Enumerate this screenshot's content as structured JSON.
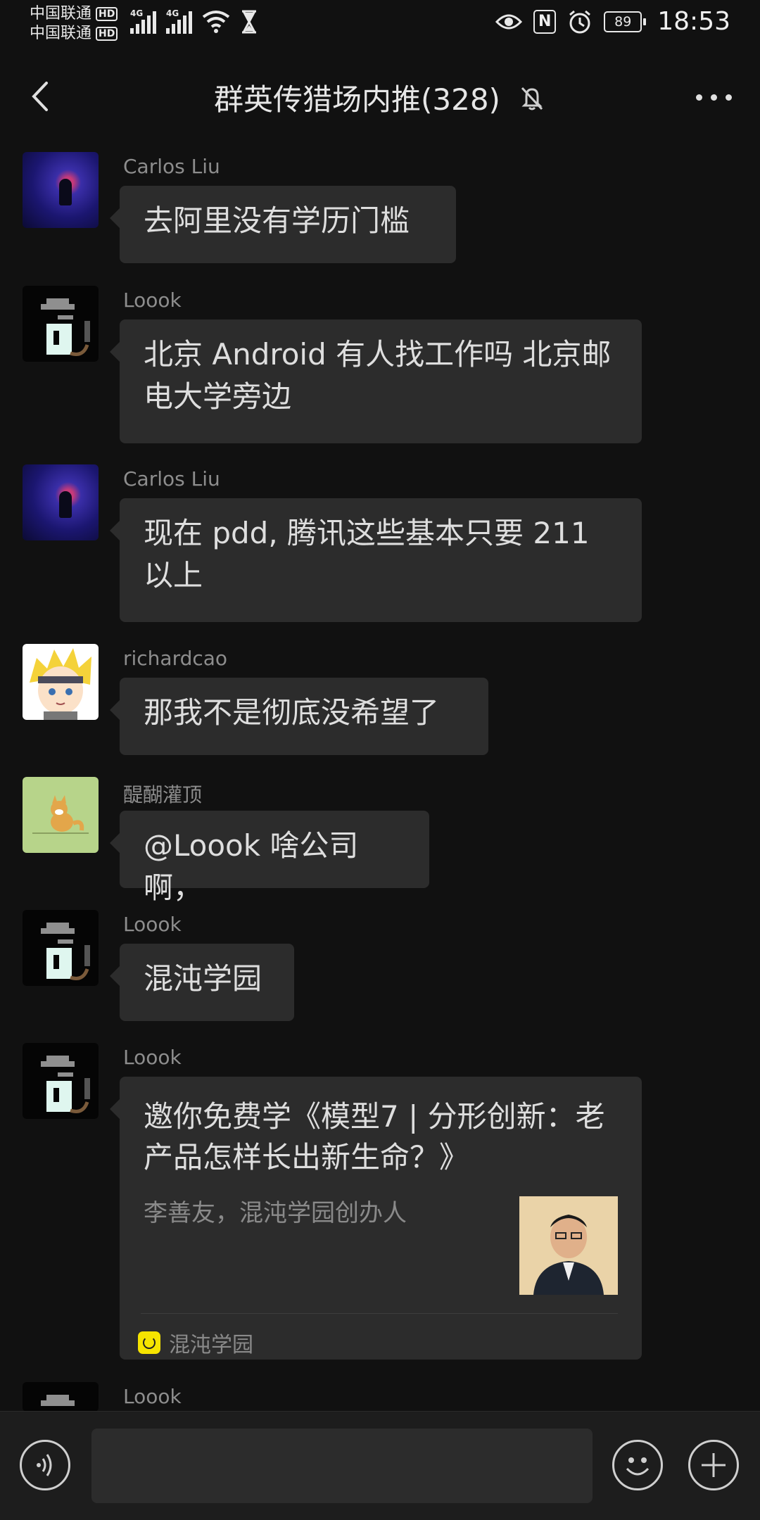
{
  "status_bar": {
    "carrier_1": "中国联通",
    "carrier_2": "中国联通",
    "hd_badge": "HD",
    "network_1": "4G",
    "network_2": "4G",
    "battery": "89",
    "time": "18:53",
    "icons": [
      "signal-icon",
      "wifi-icon",
      "hourglass-icon",
      "eye-icon",
      "nfc-icon",
      "alarm-icon",
      "battery-icon"
    ]
  },
  "header": {
    "title": "群英传猎场内推(328)",
    "icons": [
      "back-icon",
      "mute-icon",
      "more-icon"
    ]
  },
  "messages": [
    {
      "sender": "Carlos Liu",
      "text": "去阿里没有学历门槛",
      "avatar": "galaxy-avatar"
    },
    {
      "sender": "Loook",
      "text": "北京 Android 有人找工作吗   北京邮电大学旁边",
      "avatar": "pixel-avatar"
    },
    {
      "sender": "Carlos Liu",
      "text": "现在 pdd, 腾讯这些基本只要 211 以上",
      "avatar": "galaxy-avatar"
    },
    {
      "sender": "richardcao",
      "text": "那我不是彻底没希望了",
      "avatar": "anime-avatar"
    },
    {
      "sender": "醍醐灌顶",
      "text": "@Loook 啥公司啊，",
      "avatar": "fox-avatar"
    },
    {
      "sender": "Loook",
      "text": "混沌学园",
      "avatar": "pixel-avatar"
    },
    {
      "sender": "Loook",
      "avatar": "pixel-avatar",
      "card": {
        "title": "邀你免费学《模型7 | 分形创新：老产品怎样长出新生命？》",
        "description": "李善友，混沌学园创办人",
        "source": "混沌学园"
      }
    },
    {
      "sender": "Loook",
      "avatar": "pixel-avatar"
    }
  ],
  "input_bar": {
    "placeholder": "",
    "icons": [
      "voice-icon",
      "emoji-icon",
      "plus-icon"
    ]
  }
}
